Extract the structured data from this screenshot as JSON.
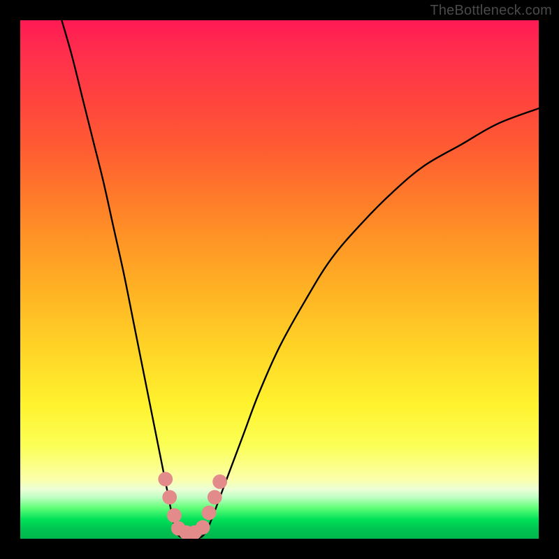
{
  "watermark": "TheBottleneck.com",
  "chart_data": {
    "type": "line",
    "title": "",
    "xlabel": "",
    "ylabel": "",
    "xlim": [
      0,
      100
    ],
    "ylim": [
      0,
      100
    ],
    "grid": false,
    "legend": false,
    "background_gradient": {
      "stops": [
        {
          "pos": 0,
          "color": "#ff1a53"
        },
        {
          "pos": 0.24,
          "color": "#ff5a33"
        },
        {
          "pos": 0.52,
          "color": "#ffb224"
        },
        {
          "pos": 0.74,
          "color": "#fff22e"
        },
        {
          "pos": 0.9,
          "color": "#ecffd6"
        },
        {
          "pos": 0.96,
          "color": "#00e158"
        },
        {
          "pos": 1.0,
          "color": "#00b54e"
        }
      ]
    },
    "series": [
      {
        "name": "left-branch",
        "stroke": "#000000",
        "x": [
          8,
          10,
          12,
          14,
          16,
          18,
          20,
          22,
          24,
          25.8,
          27.2,
          28.4,
          29.4,
          30.2
        ],
        "values": [
          100,
          93,
          85,
          77,
          69,
          60,
          51,
          41,
          31,
          22,
          15,
          9,
          4,
          1
        ]
      },
      {
        "name": "flat-minimum",
        "stroke": "#000000",
        "x": [
          30.2,
          32,
          34,
          35.6
        ],
        "values": [
          1,
          0,
          0,
          1
        ]
      },
      {
        "name": "right-branch",
        "stroke": "#000000",
        "x": [
          35.6,
          37,
          38.5,
          40,
          43,
          46,
          50,
          55,
          60,
          66,
          72,
          78,
          85,
          92,
          100
        ],
        "values": [
          1,
          4,
          8,
          12,
          20,
          28,
          37,
          46,
          54,
          61,
          67,
          72,
          76,
          80,
          83
        ]
      }
    ],
    "markers": [
      {
        "name": "minimum-band-dots",
        "color": "#e38b8b",
        "radius_approx_pct": 1.4,
        "points": [
          {
            "x": 28.0,
            "y": 11.5
          },
          {
            "x": 28.8,
            "y": 8.0
          },
          {
            "x": 29.7,
            "y": 4.5
          },
          {
            "x": 30.5,
            "y": 2.0
          },
          {
            "x": 32.0,
            "y": 1.2
          },
          {
            "x": 33.6,
            "y": 1.2
          },
          {
            "x": 35.2,
            "y": 2.2
          },
          {
            "x": 36.4,
            "y": 5.0
          },
          {
            "x": 37.5,
            "y": 8.0
          },
          {
            "x": 38.5,
            "y": 11.0
          }
        ]
      }
    ]
  }
}
